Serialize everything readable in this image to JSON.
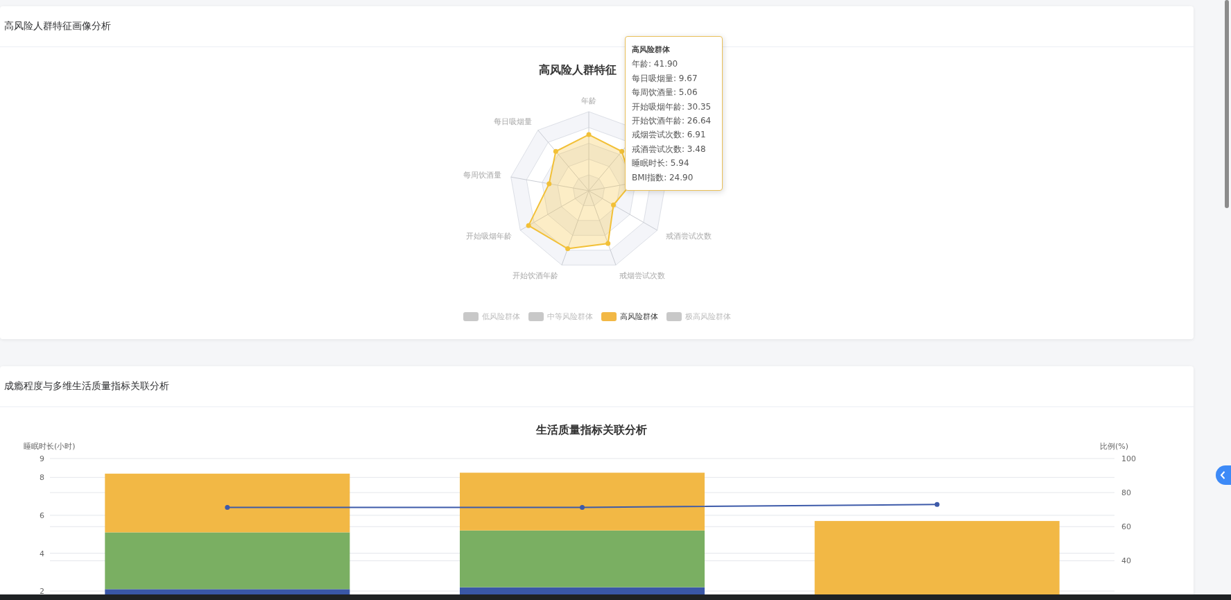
{
  "sections": [
    {
      "kind": "radar",
      "title": "高风险人群特征画像分析",
      "chart_title": "高风险人群特征",
      "axes": [
        {
          "label": "年龄"
        },
        {
          "label": "每日吸烟量"
        },
        {
          "label": "每周饮酒量"
        },
        {
          "label": "开始吸烟年龄"
        },
        {
          "label": "开始饮酒年龄"
        },
        {
          "label": "戒烟尝试次数"
        },
        {
          "label": "戒酒尝试次数"
        }
      ],
      "legend": [
        {
          "label": "低风险群体",
          "selected": false
        },
        {
          "label": "中等风险群体",
          "selected": false
        },
        {
          "label": "高风险群体",
          "selected": true
        },
        {
          "label": "极高风险群体",
          "selected": false
        }
      ],
      "tooltip": {
        "title": "高风险群体",
        "lines": [
          "年龄: 41.90",
          "每日吸烟量: 9.67",
          "每周饮酒量: 5.06",
          "开始吸烟年龄: 30.35",
          "开始饮酒年龄: 26.64",
          "戒烟尝试次数: 6.91",
          "戒酒尝试次数: 3.48",
          "睡眠时长: 5.94",
          "BMI指数: 24.90"
        ]
      }
    },
    {
      "kind": "bar",
      "title": "成瘾程度与多维生活质量指标关联分析",
      "chart_data": {
        "type": "bar",
        "title": "生活质量指标关联分析",
        "ylabel": "睡眠时长(小时)",
        "ylim": [
          0,
          9
        ],
        "yticks": [
          2,
          4,
          6,
          8,
          9
        ],
        "y2label": "比例(%)",
        "y2lim": [
          0,
          100
        ],
        "y2ticks": [
          40,
          60,
          80,
          100
        ],
        "stacked": true,
        "grid": true,
        "series": [
          {
            "color": "#3a57a7",
            "values": [
              2.1,
              2.2,
              0
            ]
          },
          {
            "color": "#7aaf62",
            "values": [
              3.0,
              3.0,
              0
            ]
          },
          {
            "color": "#f2b845",
            "values": [
              3.1,
              3.05,
              5.7
            ]
          },
          {
            "type": "line",
            "axis": "y2",
            "marker": true,
            "color": "#3d5aa9",
            "values": [
              71.3,
              71.3,
              73.0
            ]
          }
        ]
      }
    }
  ]
}
